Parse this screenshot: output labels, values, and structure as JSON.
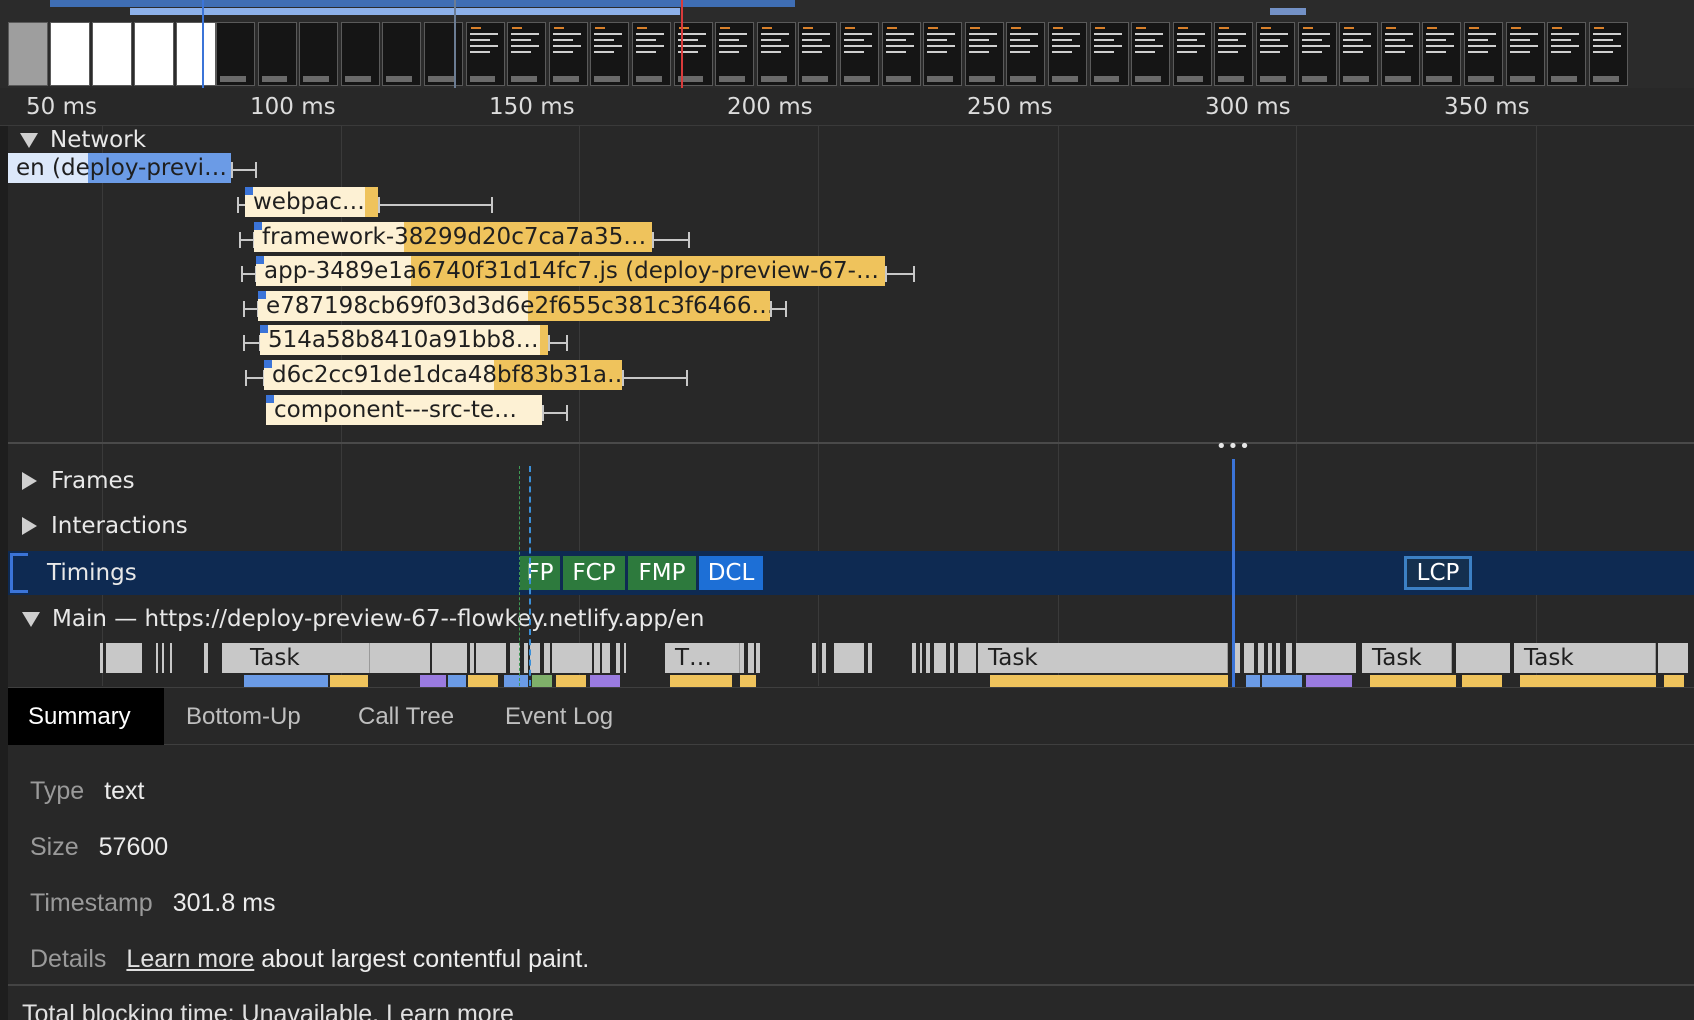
{
  "ruler": {
    "ticks": [
      "50 ms",
      "100 ms",
      "150 ms",
      "200 ms",
      "250 ms",
      "300 ms",
      "350 ms"
    ]
  },
  "network": {
    "title": "Network",
    "requests": [
      {
        "label": "en (deploy-previ…",
        "type": "document"
      },
      {
        "label": "webpac…",
        "type": "script"
      },
      {
        "label": "framework-38299d20c7ca7a35…",
        "type": "script"
      },
      {
        "label": "app-3489e1a6740f31d14fc7.js (deploy-preview-67-…",
        "type": "script"
      },
      {
        "label": "e787198cb69f03d3d6e2f655c381c3f6466…",
        "type": "script"
      },
      {
        "label": "514a58b8410a91bb8…",
        "type": "script"
      },
      {
        "label": "d6c2cc91de1dca48bf83b31a…",
        "type": "script"
      },
      {
        "label": "component---src-te…",
        "type": "script"
      }
    ]
  },
  "tracks": {
    "frames": "Frames",
    "interactions": "Interactions",
    "timings": "Timings",
    "main": "Main — https://deploy-preview-67--flowkey.netlify.app/en"
  },
  "timings_markers": [
    "FP",
    "FCP",
    "FMP",
    "DCL",
    "LCP"
  ],
  "main_tasks": [
    "Task",
    "T…",
    "Task",
    "Task",
    "Task"
  ],
  "tabs": [
    "Summary",
    "Bottom-Up",
    "Call Tree",
    "Event Log"
  ],
  "active_tab": "Summary",
  "details": {
    "type_label": "Type",
    "type_value": "text",
    "size_label": "Size",
    "size_value": "57600",
    "timestamp_label": "Timestamp",
    "timestamp_value": "301.8 ms",
    "details_label": "Details",
    "details_link": "Learn more",
    "details_text": "about largest contentful paint."
  },
  "footer": "Total blocking time: Unavailable. Learn more",
  "colors": {
    "script": "#efc35c",
    "document": "#6b9be6",
    "timings_bg": "#0e2a52",
    "paint_marker": "#2d7a3d",
    "dcl_marker": "#1d6fd6"
  }
}
